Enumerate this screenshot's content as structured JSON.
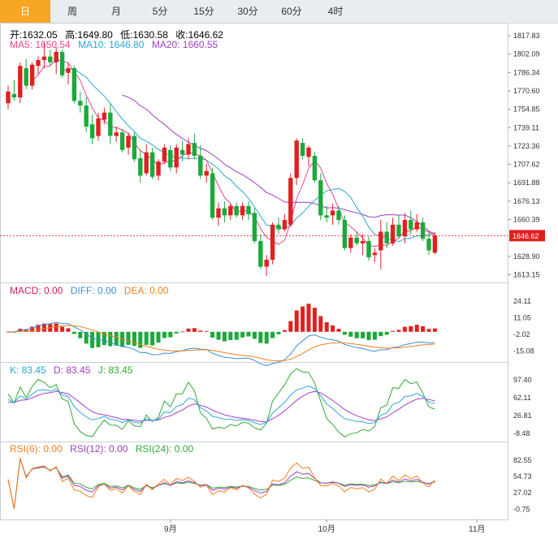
{
  "tabs": [
    "日",
    "周",
    "月",
    "5分",
    "15分",
    "30分",
    "60分",
    "4时"
  ],
  "active_tab": 0,
  "ohlc_legend": {
    "open_label": "开:",
    "open": "1632.05",
    "high_label": "高:",
    "high": "1649.80",
    "low_label": "低:",
    "low": "1630.58",
    "close_label": "收:",
    "close": "1646.62"
  },
  "ma_legend": {
    "ma5": "MA5: 1650.54",
    "ma10": "MA10: 1646.80",
    "ma20": "MA20: 1660.55"
  },
  "macd_legend": {
    "macd": "MACD: 0.00",
    "diff": "DIFF: 0.00",
    "dea": "DEA: 0.00"
  },
  "kdj_legend": {
    "k": "K: 83.45",
    "d": "D: 83.45",
    "j": "J: 83.45"
  },
  "rsi_legend": {
    "rsi6": "RSI(6): 0.00",
    "rsi12": "RSI(12): 0.00",
    "rsi24": "RSI(24): 0.00"
  },
  "colors": {
    "up": "#e02020",
    "down": "#1aaa3a",
    "ma5": "#e8478b",
    "ma10": "#2aa8d8",
    "ma20": "#a040c0",
    "diff": "#3a8fd8",
    "dea": "#f07f20",
    "k": "#2aa8d8",
    "d": "#a040c0",
    "j": "#34a834",
    "rsi6": "#f07f20",
    "rsi12": "#a040c0",
    "rsi24": "#34a834",
    "last_price_bg": "#e02020"
  },
  "chart_data": [
    {
      "type": "candlestick",
      "title": "",
      "y_ticks": [
        "1817.83",
        "1802.09",
        "1786.34",
        "1770.60",
        "1754.85",
        "1739.11",
        "1723.36",
        "1707.62",
        "1691.88",
        "1676.13",
        "1660.39",
        "1628.90",
        "1613.15"
      ],
      "ylim": [
        1610,
        1822
      ],
      "last_price": "1646.62",
      "x_labels": [
        {
          "label": "9月",
          "index": 27
        },
        {
          "label": "10月",
          "index": 53
        },
        {
          "label": "11月",
          "index": 78
        }
      ],
      "candles": [
        {
          "o": 1760,
          "h": 1775,
          "l": 1755,
          "c": 1770
        },
        {
          "o": 1768,
          "h": 1780,
          "l": 1762,
          "c": 1765
        },
        {
          "o": 1765,
          "h": 1795,
          "l": 1760,
          "c": 1792
        },
        {
          "o": 1790,
          "h": 1798,
          "l": 1772,
          "c": 1775
        },
        {
          "o": 1775,
          "h": 1795,
          "l": 1772,
          "c": 1793
        },
        {
          "o": 1792,
          "h": 1800,
          "l": 1785,
          "c": 1797
        },
        {
          "o": 1797,
          "h": 1812,
          "l": 1790,
          "c": 1800
        },
        {
          "o": 1800,
          "h": 1806,
          "l": 1792,
          "c": 1795
        },
        {
          "o": 1795,
          "h": 1808,
          "l": 1785,
          "c": 1804
        },
        {
          "o": 1804,
          "h": 1806,
          "l": 1782,
          "c": 1784
        },
        {
          "o": 1786,
          "h": 1795,
          "l": 1776,
          "c": 1790
        },
        {
          "o": 1790,
          "h": 1792,
          "l": 1760,
          "c": 1762
        },
        {
          "o": 1762,
          "h": 1770,
          "l": 1752,
          "c": 1758
        },
        {
          "o": 1758,
          "h": 1765,
          "l": 1735,
          "c": 1740
        },
        {
          "o": 1742,
          "h": 1750,
          "l": 1725,
          "c": 1730
        },
        {
          "o": 1732,
          "h": 1752,
          "l": 1728,
          "c": 1747
        },
        {
          "o": 1746,
          "h": 1756,
          "l": 1742,
          "c": 1752
        },
        {
          "o": 1752,
          "h": 1760,
          "l": 1725,
          "c": 1732
        },
        {
          "o": 1732,
          "h": 1740,
          "l": 1727,
          "c": 1735
        },
        {
          "o": 1735,
          "h": 1738,
          "l": 1718,
          "c": 1720
        },
        {
          "o": 1722,
          "h": 1735,
          "l": 1716,
          "c": 1732
        },
        {
          "o": 1732,
          "h": 1735,
          "l": 1710,
          "c": 1712
        },
        {
          "o": 1713,
          "h": 1720,
          "l": 1692,
          "c": 1698
        },
        {
          "o": 1700,
          "h": 1725,
          "l": 1698,
          "c": 1718
        },
        {
          "o": 1718,
          "h": 1722,
          "l": 1695,
          "c": 1697
        },
        {
          "o": 1698,
          "h": 1712,
          "l": 1694,
          "c": 1710
        },
        {
          "o": 1710,
          "h": 1725,
          "l": 1708,
          "c": 1722
        },
        {
          "o": 1720,
          "h": 1724,
          "l": 1702,
          "c": 1705
        },
        {
          "o": 1705,
          "h": 1725,
          "l": 1700,
          "c": 1722
        },
        {
          "o": 1720,
          "h": 1728,
          "l": 1710,
          "c": 1716
        },
        {
          "o": 1716,
          "h": 1730,
          "l": 1712,
          "c": 1725
        },
        {
          "o": 1726,
          "h": 1734,
          "l": 1712,
          "c": 1715
        },
        {
          "o": 1715,
          "h": 1724,
          "l": 1695,
          "c": 1698
        },
        {
          "o": 1698,
          "h": 1708,
          "l": 1692,
          "c": 1702
        },
        {
          "o": 1700,
          "h": 1705,
          "l": 1660,
          "c": 1662
        },
        {
          "o": 1662,
          "h": 1675,
          "l": 1655,
          "c": 1670
        },
        {
          "o": 1670,
          "h": 1676,
          "l": 1658,
          "c": 1664
        },
        {
          "o": 1664,
          "h": 1674,
          "l": 1660,
          "c": 1672
        },
        {
          "o": 1672,
          "h": 1675,
          "l": 1662,
          "c": 1664
        },
        {
          "o": 1664,
          "h": 1675,
          "l": 1660,
          "c": 1672
        },
        {
          "o": 1672,
          "h": 1676,
          "l": 1660,
          "c": 1665
        },
        {
          "o": 1666,
          "h": 1670,
          "l": 1640,
          "c": 1642
        },
        {
          "o": 1642,
          "h": 1648,
          "l": 1618,
          "c": 1620
        },
        {
          "o": 1620,
          "h": 1630,
          "l": 1612,
          "c": 1626
        },
        {
          "o": 1626,
          "h": 1658,
          "l": 1622,
          "c": 1656
        },
        {
          "o": 1656,
          "h": 1662,
          "l": 1648,
          "c": 1652
        },
        {
          "o": 1652,
          "h": 1665,
          "l": 1650,
          "c": 1660
        },
        {
          "o": 1656,
          "h": 1700,
          "l": 1654,
          "c": 1696
        },
        {
          "o": 1696,
          "h": 1730,
          "l": 1690,
          "c": 1728
        },
        {
          "o": 1726,
          "h": 1730,
          "l": 1712,
          "c": 1715
        },
        {
          "o": 1714,
          "h": 1724,
          "l": 1706,
          "c": 1722
        },
        {
          "o": 1715,
          "h": 1718,
          "l": 1692,
          "c": 1694
        },
        {
          "o": 1694,
          "h": 1700,
          "l": 1660,
          "c": 1664
        },
        {
          "o": 1664,
          "h": 1672,
          "l": 1658,
          "c": 1662
        },
        {
          "o": 1664,
          "h": 1674,
          "l": 1656,
          "c": 1668
        },
        {
          "o": 1668,
          "h": 1672,
          "l": 1656,
          "c": 1660
        },
        {
          "o": 1660,
          "h": 1664,
          "l": 1634,
          "c": 1636
        },
        {
          "o": 1636,
          "h": 1648,
          "l": 1632,
          "c": 1645
        },
        {
          "o": 1645,
          "h": 1650,
          "l": 1638,
          "c": 1640
        },
        {
          "o": 1640,
          "h": 1648,
          "l": 1630,
          "c": 1642
        },
        {
          "o": 1642,
          "h": 1646,
          "l": 1625,
          "c": 1628
        },
        {
          "o": 1630,
          "h": 1636,
          "l": 1624,
          "c": 1632
        },
        {
          "o": 1634,
          "h": 1660,
          "l": 1618,
          "c": 1650
        },
        {
          "o": 1650,
          "h": 1658,
          "l": 1636,
          "c": 1640
        },
        {
          "o": 1640,
          "h": 1662,
          "l": 1638,
          "c": 1656
        },
        {
          "o": 1656,
          "h": 1664,
          "l": 1644,
          "c": 1646
        },
        {
          "o": 1646,
          "h": 1666,
          "l": 1640,
          "c": 1660
        },
        {
          "o": 1660,
          "h": 1668,
          "l": 1648,
          "c": 1652
        },
        {
          "o": 1652,
          "h": 1665,
          "l": 1650,
          "c": 1658
        },
        {
          "o": 1658,
          "h": 1662,
          "l": 1642,
          "c": 1644
        },
        {
          "o": 1644,
          "h": 1650,
          "l": 1630,
          "c": 1634
        },
        {
          "o": 1632.05,
          "h": 1649.8,
          "l": 1630.58,
          "c": 1646.62
        }
      ]
    },
    {
      "type": "bar+line",
      "name": "MACD",
      "y_ticks": [
        "24.11",
        "11.05",
        "-2.02",
        "-15.08"
      ],
      "ylim": [
        -20,
        30
      ]
    },
    {
      "type": "line",
      "name": "KDJ",
      "y_ticks": [
        "97.40",
        "62.11",
        "26.81",
        "-8.48"
      ],
      "ylim": [
        -15,
        110
      ]
    },
    {
      "type": "line",
      "name": "RSI",
      "y_ticks": [
        "82.55",
        "54.73",
        "27.02",
        "-0.75"
      ],
      "ylim": [
        -10,
        95
      ]
    }
  ]
}
